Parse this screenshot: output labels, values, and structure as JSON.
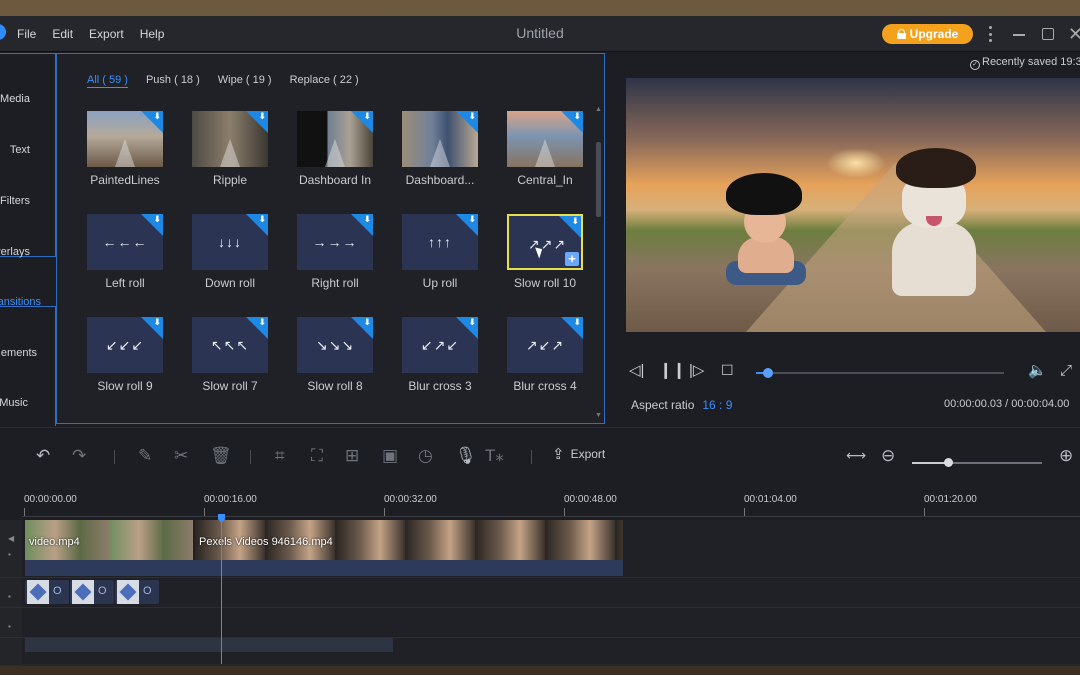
{
  "titlebar": {
    "menu": [
      "File",
      "Edit",
      "Export",
      "Help"
    ],
    "title": "Untitled",
    "upgrade_label": "Upgrade"
  },
  "sidebar": {
    "items": [
      "Media",
      "Text",
      "Filters",
      "Overlays",
      "ansitions",
      "ements",
      "Music"
    ]
  },
  "tabs": [
    "All ( 59 )",
    "Push ( 18 )",
    "Wipe ( 19 )",
    "Replace ( 22 )"
  ],
  "transitions": [
    {
      "label": "PaintedLines",
      "thumb": "photo",
      "glyph": ""
    },
    {
      "label": "Ripple",
      "thumb": "photo2",
      "glyph": ""
    },
    {
      "label": "Dashboard In",
      "thumb": "photo3",
      "glyph": ""
    },
    {
      "label": "Dashboard...",
      "thumb": "photo4",
      "glyph": ""
    },
    {
      "label": "Central_In",
      "thumb": "photo5",
      "glyph": ""
    },
    {
      "label": "Left roll",
      "thumb": "icon",
      "glyph": "←←←"
    },
    {
      "label": "Down roll",
      "thumb": "icon",
      "glyph": "↓↓↓"
    },
    {
      "label": "Right roll",
      "thumb": "icon",
      "glyph": "→→→"
    },
    {
      "label": "Up roll",
      "thumb": "icon",
      "glyph": "↑↑↑"
    },
    {
      "label": "Slow roll 10",
      "thumb": "icon",
      "glyph": "↗↗↗"
    },
    {
      "label": "Slow roll 9",
      "thumb": "icon",
      "glyph": "↙↙↙"
    },
    {
      "label": "Slow roll 7",
      "thumb": "icon",
      "glyph": "↖↖↖"
    },
    {
      "label": "Slow roll 8",
      "thumb": "icon",
      "glyph": "↘↘↘"
    },
    {
      "label": "Blur cross 3",
      "thumb": "icon",
      "glyph": "↙↗↙"
    },
    {
      "label": "Blur cross 4",
      "thumb": "icon",
      "glyph": "↗↙↗"
    }
  ],
  "preview": {
    "saved_text": "Recently saved 19:3",
    "aspect_label": "Aspect ratio",
    "aspect_value": "16 : 9",
    "timecode": "00:00:00.03 / 00:00:04.00",
    "progress": 0.05
  },
  "toolbar": {
    "export_label": "Export",
    "zoom": 0.28
  },
  "timeline": {
    "ticks": [
      "00:00:00.00",
      "00:00:16.00",
      "00:00:32.00",
      "00:00:48.00",
      "00:01:04.00",
      "00:01:20.00"
    ],
    "clips": [
      "video.mp4",
      "Pexels Videos 946146.mp4"
    ],
    "overlay_chip_text": "O"
  },
  "colors": {
    "accent": "#3a8fff",
    "upgrade": "#f4a11e",
    "download_badge": "#1e88e5",
    "selected_outline": "#e9df4c"
  }
}
